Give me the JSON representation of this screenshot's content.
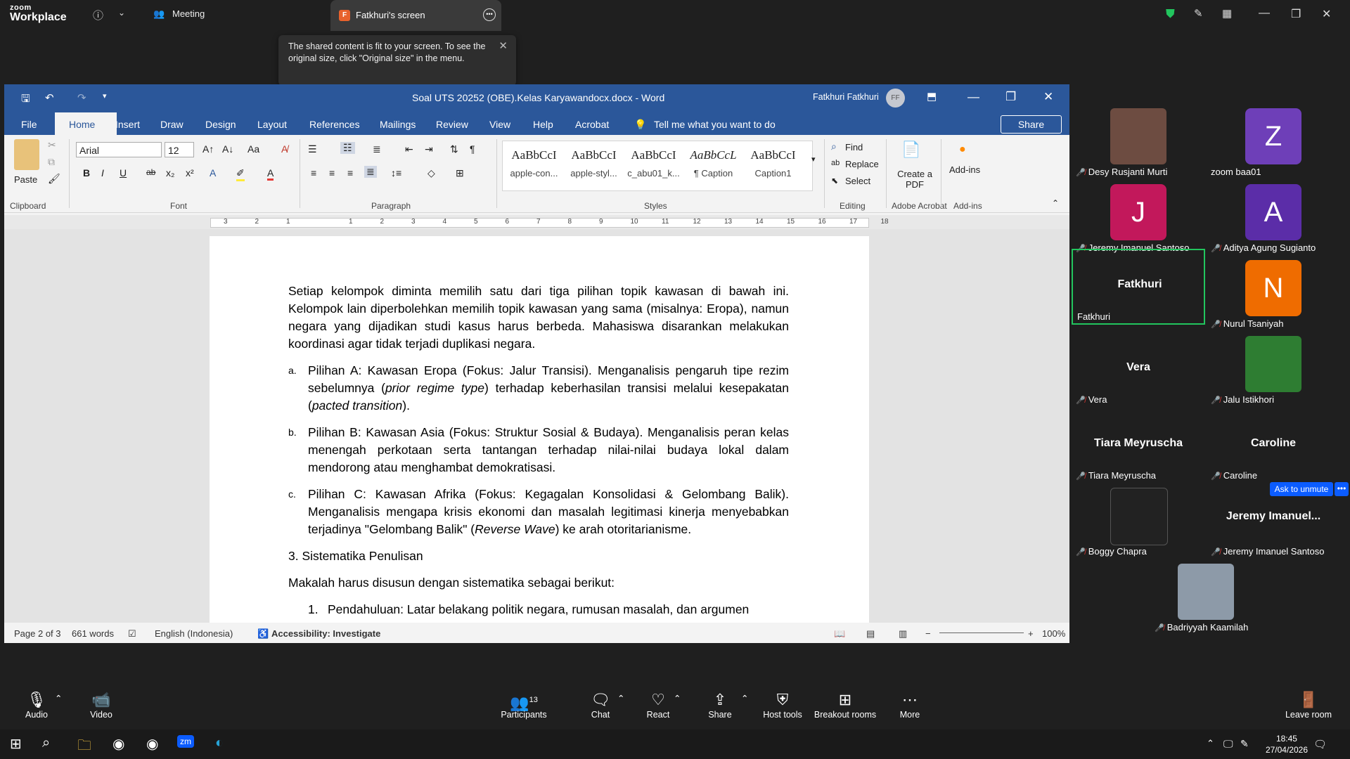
{
  "zoom": {
    "logo_line1": "zoom",
    "logo_line2": "Workplace",
    "meeting_tab": "Meeting",
    "share_tab": "Fatkhuri's screen",
    "share_badge": "F",
    "tooltip": "The shared content is fit to your screen. To see the original size, click \"Original size\" in the menu."
  },
  "word": {
    "title": "Soal UTS 20252 (OBE).Kelas Karyawandocx.docx  -  Word",
    "user_name": "Fatkhuri Fatkhuri",
    "user_initials": "FF",
    "tabs": [
      "File",
      "Home",
      "Insert",
      "Draw",
      "Design",
      "Layout",
      "References",
      "Mailings",
      "Review",
      "View",
      "Help",
      "Acrobat"
    ],
    "tell_me": "Tell me what you want to do",
    "share": "Share",
    "font_name": "Arial",
    "font_size": "12",
    "styles": [
      {
        "sample": "AaBbCcI",
        "name": "apple-con..."
      },
      {
        "sample": "AaBbCcI",
        "name": "apple-styl..."
      },
      {
        "sample": "AaBbCcI",
        "name": "c_abu01_k..."
      },
      {
        "sample": "AaBbCcL",
        "name": "¶ Caption"
      },
      {
        "sample": "AaBbCcI",
        "name": "Caption1"
      }
    ],
    "editing": {
      "find": "Find",
      "replace": "Replace",
      "select": "Select"
    },
    "paste": "Paste",
    "create_pdf": "Create a PDF",
    "addins": "Add-ins",
    "groups": [
      "Clipboard",
      "Font",
      "Paragraph",
      "Styles",
      "Editing",
      "Adobe Acrobat",
      "Add-ins"
    ],
    "doc": {
      "intro": "Setiap kelompok diminta memilih satu dari tiga pilihan topik kawasan di bawah ini. Kelompok lain diperbolehkan memilih topik kawasan yang sama (misalnya: Eropa), namun negara yang dijadikan studi kasus harus berbeda. Mahasiswa disarankan melakukan koordinasi agar tidak terjadi duplikasi negara.",
      "a_marker": "a.",
      "a_text1": "Pilihan A: Kawasan Eropa (Fokus: Jalur Transisi). Menganalisis pengaruh tipe rezim sebelumnya (",
      "a_em1": "prior regime type",
      "a_text2": ") terhadap keberhasilan transisi melalui kesepakatan (",
      "a_em2": "pacted transition",
      "a_text3": ").",
      "b_marker": "b.",
      "b_text": "Pilihan B: Kawasan Asia (Fokus: Struktur Sosial & Budaya). Menganalisis peran kelas menengah perkotaan serta tantangan terhadap nilai-nilai budaya lokal dalam mendorong atau menghambat demokratisasi.",
      "c_marker": "c.",
      "c_text1": "Pilihan C: Kawasan Afrika (Fokus: Kegagalan Konsolidasi & Gelombang Balik). Menganalisis mengapa krisis ekonomi dan masalah legitimasi kinerja menyebabkan terjadinya \"Gelombang Balik\" (",
      "c_em": "Reverse Wave",
      "c_text2": ") ke arah otoritarianisme.",
      "heading": "3. Sistematika Penulisan",
      "sys_intro": "Makalah harus disusun dengan sistematika sebagai berikut:",
      "item1_marker": "1.",
      "item1": "Pendahuluan: Latar belakang politik negara, rumusan masalah, dan argumen"
    },
    "status": {
      "page": "Page 2 of 3",
      "words": "661 words",
      "language": "English (Indonesia)",
      "accessibility": "Accessibility: Investigate",
      "zoom": "100%"
    }
  },
  "participants": [
    {
      "name": "Desy Rusjanti Murti"
    },
    {
      "name": "zoom baa01",
      "initial": "Z",
      "color": "#6e3fb8"
    },
    {
      "name": "Jeremy Imanuel Santoso",
      "initial": "J",
      "color": "#c2185b"
    },
    {
      "name": "Aditya Agung Sugianto",
      "initial": "A",
      "color": "#5b2da8"
    },
    {
      "name": "Fatkhuri",
      "display": "Fatkhuri"
    },
    {
      "name": "Nurul Tsaniyah",
      "initial": "N",
      "color": "#ef6c00"
    },
    {
      "name": "Vera",
      "display": "Vera"
    },
    {
      "name": "Jalu Istikhori"
    },
    {
      "name": "Tiara Meyruscha",
      "display": "Tiara Meyruscha"
    },
    {
      "name": "Caroline",
      "display": "Caroline"
    },
    {
      "name": "Boggy Chapra"
    },
    {
      "name": "Jeremy Imanuel Santoso",
      "display": "Jeremy Imanuel..."
    },
    {
      "name": "Badriyyah Kaamilah"
    }
  ],
  "ask_unmute": "Ask to unmute",
  "toolbar": {
    "audio": "Audio",
    "video": "Video",
    "participants": "Participants",
    "participants_count": "13",
    "chat": "Chat",
    "react": "React",
    "share": "Share",
    "host_tools": "Host tools",
    "breakout": "Breakout rooms",
    "more": "More",
    "leave": "Leave room"
  },
  "clock": {
    "time": "18:45",
    "date": "27/04/2026"
  },
  "colors": {
    "word_blue": "#2b579a",
    "zoom_bg": "#1f1f1f",
    "active_border": "#22c55e",
    "unmute": "#0b5cff"
  }
}
